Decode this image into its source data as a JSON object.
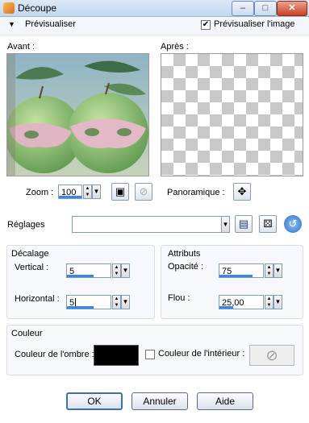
{
  "window": {
    "title": "Découpe",
    "minimize_glyph": "–",
    "maximize_glyph": "□",
    "close_glyph": "✕"
  },
  "preview": {
    "toggle_label": "Prévisualiser",
    "checkbox_label": "Prévisualiser l'image",
    "checkbox_checked": true
  },
  "panes": {
    "before_label": "Avant :",
    "after_label": "Après :"
  },
  "zoom": {
    "label": "Zoom :",
    "value": "100",
    "pan_label": "Panoramique :"
  },
  "presets": {
    "label": "Réglages",
    "value": ""
  },
  "offset": {
    "group_label": "Décalage",
    "vertical_label": "Vertical :",
    "vertical_value": "5",
    "horizontal_label": "Horizontal :",
    "horizontal_value": "5"
  },
  "attributes": {
    "group_label": "Attributs",
    "opacity_label": "Opacité :",
    "opacity_value": "75",
    "blur_label": "Flou :",
    "blur_value": "25,00"
  },
  "color": {
    "group_label": "Couleur",
    "shadow_label": "Couleur de l'ombre :",
    "shadow_color": "#000000",
    "inner_label": "Couleur de l'intérieur :",
    "inner_checked": false
  },
  "buttons": {
    "ok": "OK",
    "cancel": "Annuler",
    "help": "Aide"
  },
  "colors": {
    "accent": "#3a86e8",
    "window_frame": "#b8d6f2"
  }
}
